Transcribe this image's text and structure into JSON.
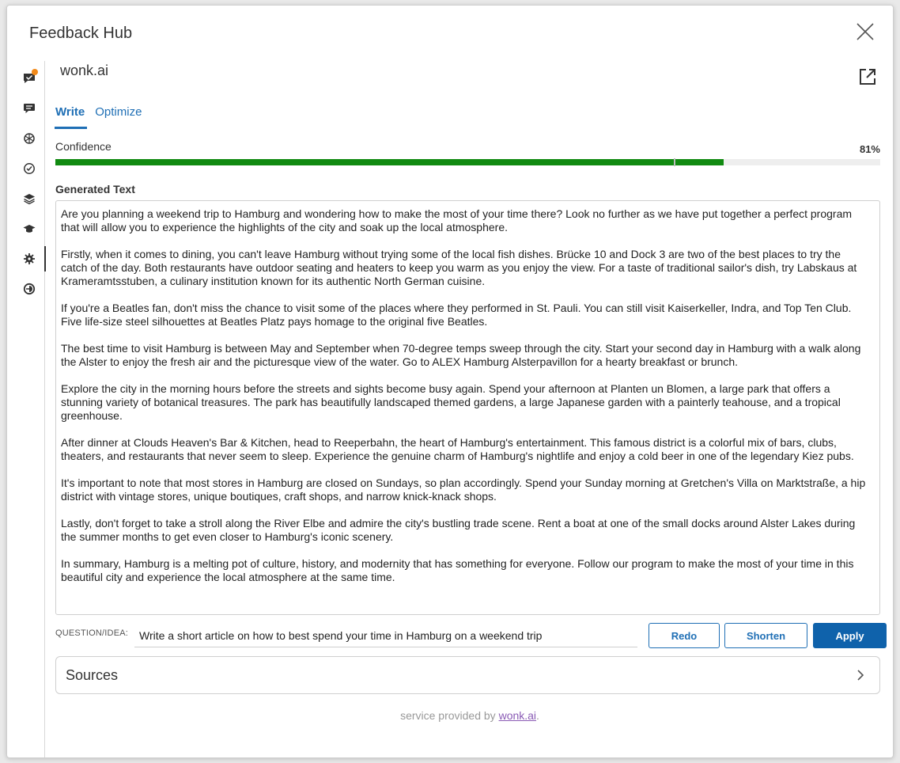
{
  "window": {
    "title": "Feedback Hub",
    "close_icon": "close-icon"
  },
  "rail": {
    "items": [
      {
        "icon": "feedback-chat-icon",
        "badge": true
      },
      {
        "icon": "chat-bubble-icon"
      },
      {
        "icon": "openai-icon"
      },
      {
        "icon": "clock-check-icon"
      },
      {
        "icon": "layers-icon"
      },
      {
        "icon": "graduation-cap-icon"
      },
      {
        "icon": "puzzle-gear-icon",
        "active": true
      },
      {
        "icon": "circle-half-icon"
      }
    ],
    "badge_color": "#f28a1a"
  },
  "main": {
    "brand": "wonk.ai",
    "external_icon": "open-external-icon",
    "tabs": [
      {
        "label": "Write",
        "active": true
      },
      {
        "label": "Optimize",
        "active": false
      }
    ],
    "confidence": {
      "label": "Confidence",
      "value_text": "81%",
      "value": 81,
      "marker": 75,
      "color": "#118a11"
    },
    "generated_label": "Generated Text",
    "paragraphs": [
      "Are you planning a weekend trip to Hamburg and wondering how to make the most of your time there? Look no further as we have put together a perfect program that will allow you to experience the highlights of the city and soak up the local atmosphere.",
      "Firstly, when it comes to dining, you can't leave Hamburg without trying some of the local fish dishes. Brücke 10 and Dock 3 are two of the best places to try the catch of the day. Both restaurants have outdoor seating and heaters to keep you warm as you enjoy the view. For a taste of traditional sailor's dish, try Labskaus at Krameramtsstuben, a culinary institution known for its authentic North German cuisine.",
      "If you're a Beatles fan, don't miss the chance to visit some of the places where they performed in St. Pauli. You can still visit Kaiserkeller, Indra, and Top Ten Club. Five life-size steel silhouettes at Beatles Platz pays homage to the original five Beatles.",
      "The best time to visit Hamburg is between May and September when 70-degree temps sweep through the city. Start your second day in Hamburg with a walk along the Alster to enjoy the fresh air and the picturesque view of the water. Go to ALEX Hamburg Alsterpavillon for a hearty breakfast or brunch.",
      "Explore the city in the morning hours before the streets and sights become busy again. Spend your afternoon at Planten un Blomen, a large park that offers a stunning variety of botanical treasures. The park has beautifully landscaped themed gardens, a large Japanese garden with a painterly teahouse, and a tropical greenhouse.",
      "After dinner at Clouds Heaven's Bar & Kitchen, head to Reeperbahn, the heart of Hamburg's entertainment. This famous district is a colorful mix of bars, clubs, theaters, and restaurants that never seem to sleep. Experience the genuine charm of Hamburg's nightlife and enjoy a cold beer in one of the legendary Kiez pubs.",
      "It's important to note that most stores in Hamburg are closed on Sundays, so plan accordingly. Spend your Sunday morning at Gretchen's Villa on Marktstraße, a hip district with vintage stores, unique boutiques, craft shops, and narrow knick-knack shops.",
      "Lastly, don't forget to take a stroll along the River Elbe and admire the city's bustling trade scene. Rent a boat at one of the small docks around Alster Lakes during the summer months to get even closer to Hamburg's iconic scenery.",
      "In summary, Hamburg is a melting pot of culture, history, and modernity that has something for everyone. Follow our program to make the most of your time in this beautiful city and experience the local atmosphere at the same time."
    ],
    "question": {
      "label": "QUESTION/IDEA:",
      "value": "Write a short article on how to best spend your time in Hamburg on a weekend trip"
    },
    "buttons": {
      "redo": "Redo",
      "shorten": "Shorten",
      "apply": "Apply"
    },
    "sources": {
      "label": "Sources",
      "icon": "chevron-right-icon"
    },
    "footer": {
      "prefix": "service provided by ",
      "link": "wonk.ai",
      "suffix": "."
    },
    "colors": {
      "accent": "#1f6fb5",
      "primary_button": "#0f62ab",
      "link": "#8a5bb5"
    }
  }
}
